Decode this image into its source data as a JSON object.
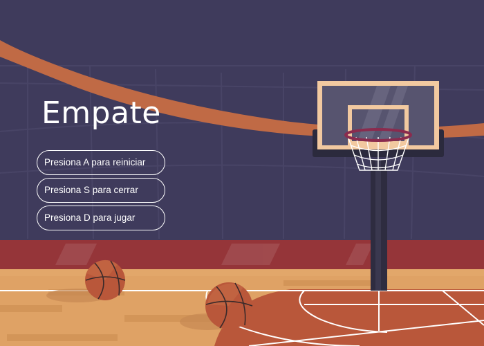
{
  "game": {
    "title": "Empate",
    "options": [
      {
        "label": "Presiona A para reiniciar"
      },
      {
        "label": "Presiona S para cerrar"
      },
      {
        "label": "Presiona D para jugar"
      }
    ]
  },
  "colors": {
    "wall": "#3f3b5c",
    "wall_stripe": "#c06a45",
    "red_band": "#953539",
    "floor": "#dfa265",
    "court_paint": "#b9573a",
    "backboard_frame": "#f2c9a0",
    "hoop_rim": "#8a2b4e"
  },
  "scene_items": {
    "basketballs": 2,
    "icons": [
      "basketball-icon",
      "basketball-hoop-icon"
    ]
  }
}
